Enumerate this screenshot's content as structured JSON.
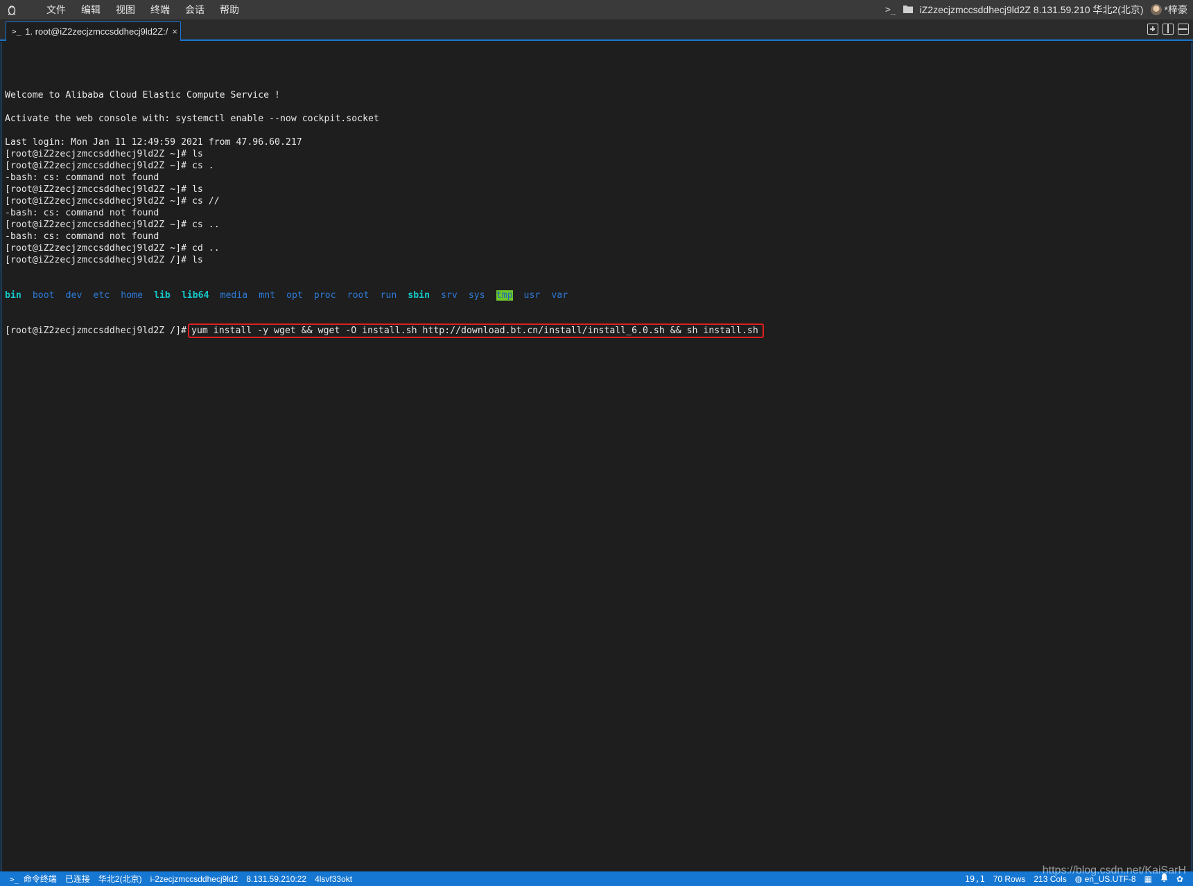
{
  "menubar": {
    "items": [
      "文件",
      "编辑",
      "视图",
      "终端",
      "会话",
      "帮助"
    ],
    "host_info": "iZ2zecjzmccsddhecj9ld2Z 8.131.59.210 华北2(北京)",
    "user": "*梓豪"
  },
  "tab": {
    "label": "1. root@iZ2zecjzmccsddhecj9ld2Z:/",
    "close": "×"
  },
  "terminal": {
    "lines": [
      "",
      "Welcome to Alibaba Cloud Elastic Compute Service !",
      "",
      "Activate the web console with: systemctl enable --now cockpit.socket",
      "",
      "Last login: Mon Jan 11 12:49:59 2021 from 47.96.60.217",
      "[root@iZ2zecjzmccsddhecj9ld2Z ~]# ls",
      "[root@iZ2zecjzmccsddhecj9ld2Z ~]# cs .",
      "-bash: cs: command not found",
      "[root@iZ2zecjzmccsddhecj9ld2Z ~]# ls",
      "[root@iZ2zecjzmccsddhecj9ld2Z ~]# cs //",
      "-bash: cs: command not found",
      "[root@iZ2zecjzmccsddhecj9ld2Z ~]# cs ..",
      "-bash: cs: command not found",
      "[root@iZ2zecjzmccsddhecj9ld2Z ~]# cd ..",
      "[root@iZ2zecjzmccsddhecj9ld2Z /]# ls"
    ],
    "ls_dirs": [
      {
        "name": "bin",
        "style": "cyan"
      },
      {
        "name": "boot",
        "style": "blue"
      },
      {
        "name": "dev",
        "style": "blue"
      },
      {
        "name": "etc",
        "style": "blue"
      },
      {
        "name": "home",
        "style": "blue"
      },
      {
        "name": "lib",
        "style": "cyan"
      },
      {
        "name": "lib64",
        "style": "cyan"
      },
      {
        "name": "media",
        "style": "blue"
      },
      {
        "name": "mnt",
        "style": "blue"
      },
      {
        "name": "opt",
        "style": "blue"
      },
      {
        "name": "proc",
        "style": "blue"
      },
      {
        "name": "root",
        "style": "blue"
      },
      {
        "name": "run",
        "style": "blue"
      },
      {
        "name": "sbin",
        "style": "cyan"
      },
      {
        "name": "srv",
        "style": "blue"
      },
      {
        "name": "sys",
        "style": "blue"
      },
      {
        "name": "tmp",
        "style": "tmp"
      },
      {
        "name": "usr",
        "style": "blue"
      },
      {
        "name": "var",
        "style": "blue"
      }
    ],
    "prompt": "[root@iZ2zecjzmccsddhecj9ld2Z /]#",
    "command": "yum install -y wget && wget -O install.sh http://download.bt.cn/install/install_6.0.sh && sh install.sh"
  },
  "statusbar": {
    "mode": "命令终端",
    "connection": "已连接",
    "region": "华北2(北京)",
    "instance": "i-2zecjzmccsddhecj9ld2",
    "address": "8.131.59.210:22",
    "session": "4lsvf33okt",
    "cursor": "19,1",
    "rows": "70 Rows",
    "cols": "213 Cols",
    "encoding": "en_US.UTF-8"
  },
  "watermark": "https://blog.csdn.net/KaiSarH",
  "colors": {
    "accent": "#1677d2",
    "terminal_bg": "#1e1e1e",
    "highlight_border": "#e02020"
  }
}
